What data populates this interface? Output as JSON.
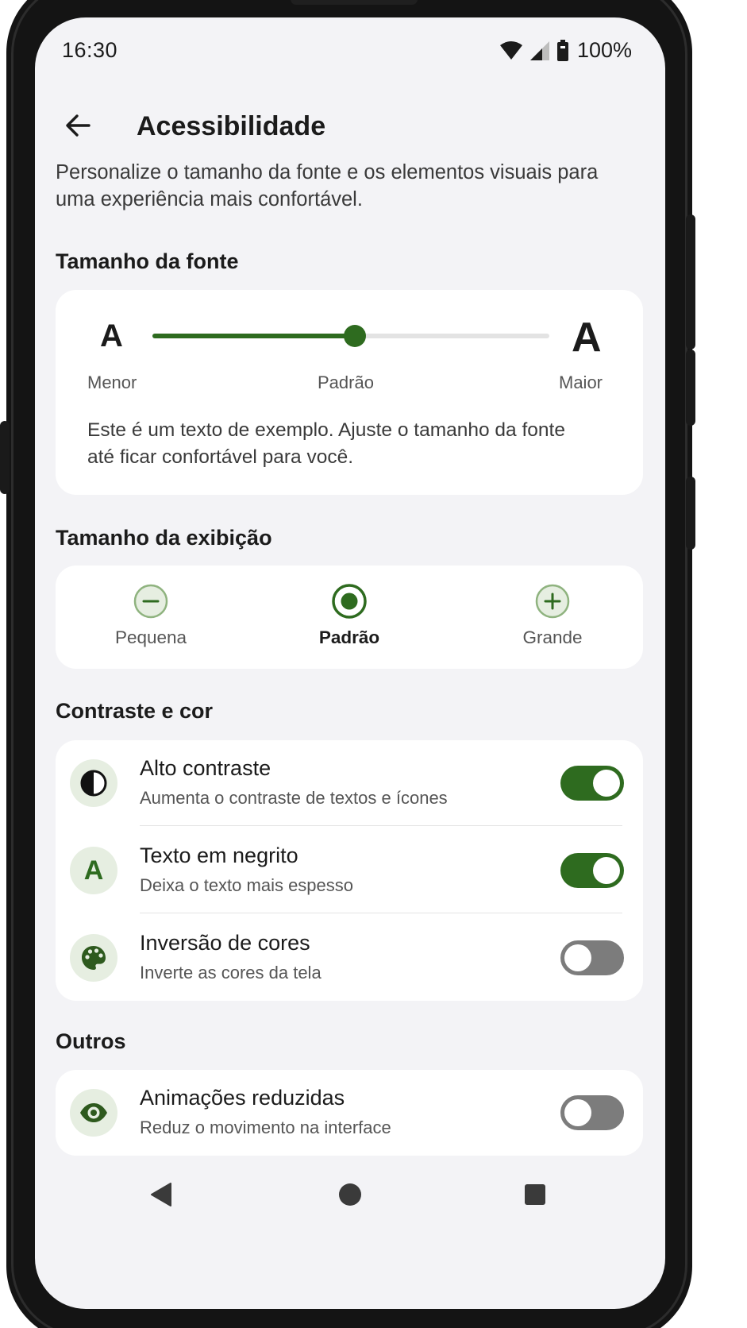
{
  "colors": {
    "accent": "#2e6b1f",
    "icon_bg": "#e6eee1",
    "screen_bg": "#f3f3f6",
    "card_bg": "#ffffff",
    "toggle_off": "#7c7c7c"
  },
  "status_bar": {
    "time": "16:30",
    "battery_text": "100%",
    "icons": [
      "wifi-icon",
      "signal-icon",
      "battery-icon"
    ]
  },
  "app_bar": {
    "title": "Acessibilidade",
    "back_icon": "arrow-left-icon"
  },
  "intro": "Personalize o tamanho da fonte e os elementos visuais para uma experiência mais confortável.",
  "font_size": {
    "section_title": "Tamanho da fonte",
    "small_glyph": "A",
    "large_glyph": "A",
    "label_min": "Menor",
    "label_mid": "Padrão",
    "label_max": "Maior",
    "slider_value_fraction": 0.51,
    "sample_text": "Este é um texto de exemplo. Ajuste o tamanho da fonte até ficar confortável para você."
  },
  "display_size": {
    "section_title": "Tamanho da exibição",
    "options": [
      {
        "label": "Pequena",
        "icon": "minus-circle-icon",
        "selected": false
      },
      {
        "label": "Padrão",
        "icon": "radio-selected-icon",
        "selected": true
      },
      {
        "label": "Grande",
        "icon": "plus-circle-icon",
        "selected": false
      }
    ]
  },
  "contrast": {
    "section_title": "Contraste e cor",
    "items": [
      {
        "title": "Alto contraste",
        "subtitle": "Aumenta o contraste de textos e ícones",
        "icon": "contrast-icon",
        "enabled": true
      },
      {
        "title": "Texto em negrito",
        "subtitle": "Deixa o texto mais espesso",
        "icon": "bold-text-icon",
        "icon_glyph": "A",
        "enabled": true
      },
      {
        "title": "Inversão de cores",
        "subtitle": "Inverte as cores da tela",
        "icon": "palette-icon",
        "enabled": false
      }
    ]
  },
  "others": {
    "section_title": "Outros",
    "items": [
      {
        "title": "Animações reduzidas",
        "subtitle": "Reduz o movimento na interface",
        "icon": "eye-icon",
        "enabled": false
      }
    ]
  },
  "nav_bar": {
    "icons": [
      "nav-back-icon",
      "nav-home-icon",
      "nav-recents-icon"
    ]
  }
}
